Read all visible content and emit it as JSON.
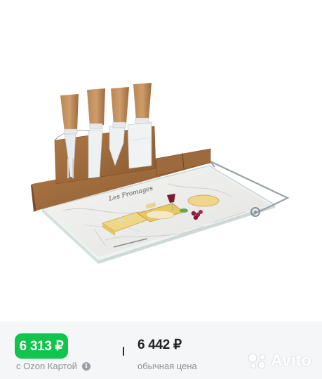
{
  "listing": {
    "photo_description_icon": "cheese-board-product-photo",
    "board_title": "Les Fromages"
  },
  "prices": {
    "ozon_card_price": "6 313 ₽",
    "ozon_card_caption": "с Ozon Картой",
    "regular_price": "6 442 ₽",
    "regular_caption": "обычная цена",
    "accent_color": "#10c44c"
  },
  "watermark": {
    "brand": "Avito"
  }
}
